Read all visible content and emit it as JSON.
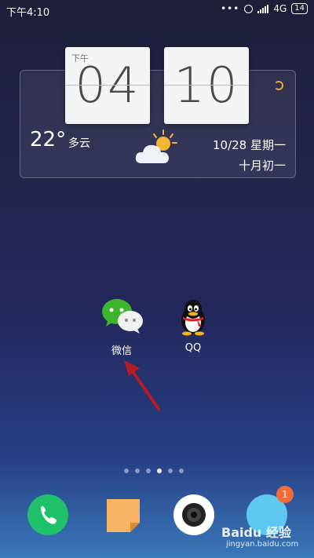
{
  "status_bar": {
    "time": "下午4:10",
    "dots": "•••",
    "network": "4G",
    "battery": "14"
  },
  "clock": {
    "ampm": "下午",
    "hour": "04",
    "minute": "10"
  },
  "weather": {
    "temperature": "22°",
    "condition": "多云",
    "date": "10/28  星期一",
    "lunar": "十月初一"
  },
  "apps": [
    {
      "label": "微信"
    },
    {
      "label": "QQ"
    }
  ],
  "dock": {
    "browser_badge": "1"
  },
  "watermark": {
    "brand": "Baidu 经验",
    "url": "jingyan.baidu.com"
  },
  "colors": {
    "accent_refresh": "#f0a830",
    "phone": "#1fc16b",
    "badge": "#f26b3a",
    "arrow": "#b71c24"
  }
}
